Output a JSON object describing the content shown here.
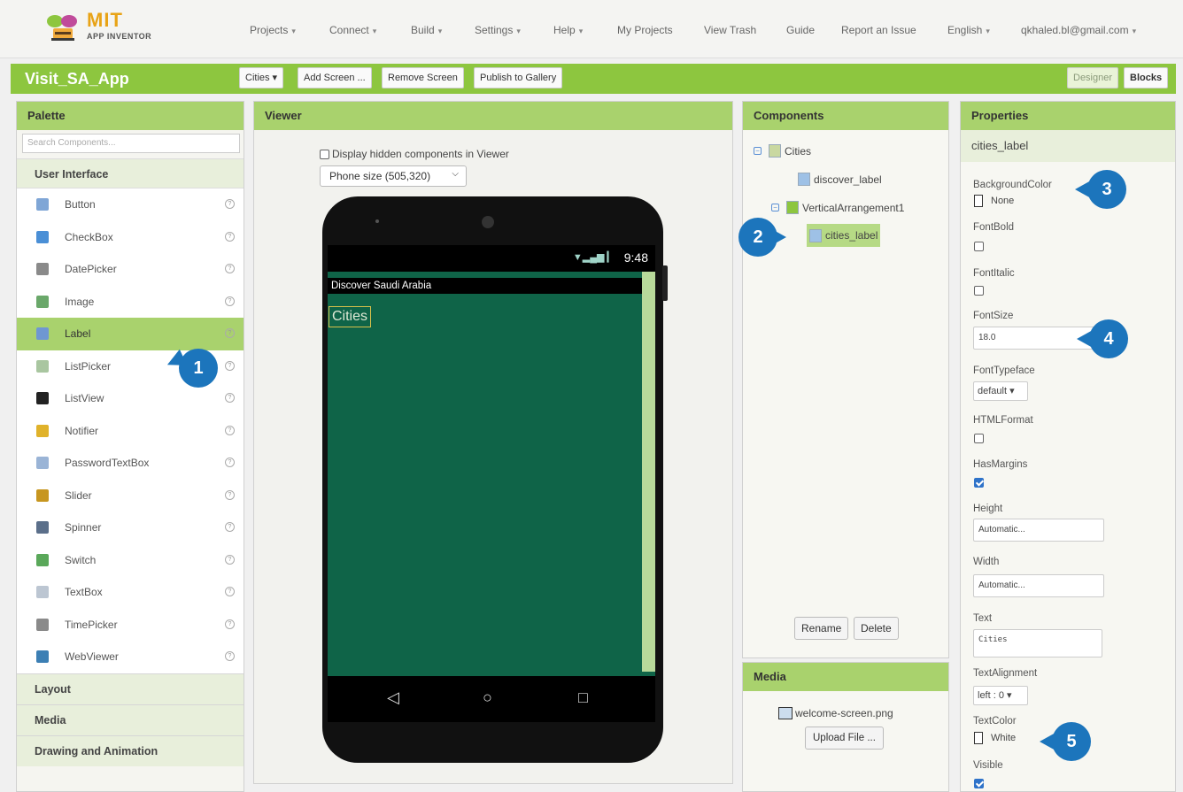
{
  "app": {
    "logo_top": "MIT",
    "logo_bottom": "APP INVENTOR",
    "nav": [
      {
        "label": "Projects",
        "caret": true
      },
      {
        "label": "Connect",
        "caret": true
      },
      {
        "label": "Build",
        "caret": true
      },
      {
        "label": "Settings",
        "caret": true
      },
      {
        "label": "Help",
        "caret": true
      },
      {
        "label": "My Projects",
        "caret": false
      },
      {
        "label": "View Trash",
        "caret": false
      },
      {
        "label": "Guide",
        "caret": false
      },
      {
        "label": "Report an Issue",
        "caret": false
      },
      {
        "label": "English",
        "caret": true
      },
      {
        "label": "qkhaled.bl@gmail.com",
        "caret": true
      }
    ]
  },
  "toolbar": {
    "project_name": "Visit_SA_App",
    "screen_select": "Cities ▾",
    "add_screen": "Add Screen ...",
    "remove_screen": "Remove Screen",
    "publish": "Publish to Gallery",
    "designer": "Designer",
    "blocks": "Blocks"
  },
  "palette": {
    "title": "Palette",
    "search_placeholder": "Search Components...",
    "category": "User Interface",
    "items": [
      {
        "label": "Button",
        "icon": "button-icon",
        "color": "#7fa6d6"
      },
      {
        "label": "CheckBox",
        "icon": "checkbox-icon",
        "color": "#4a8fd6"
      },
      {
        "label": "DatePicker",
        "icon": "datepicker-icon",
        "color": "#8a8a8a"
      },
      {
        "label": "Image",
        "icon": "image-icon",
        "color": "#6aa86a"
      },
      {
        "label": "Label",
        "icon": "label-icon",
        "color": "#6f97d2"
      },
      {
        "label": "ListPicker",
        "icon": "listpicker-icon",
        "color": "#a9c6a0"
      },
      {
        "label": "ListView",
        "icon": "listview-icon",
        "color": "#222222"
      },
      {
        "label": "Notifier",
        "icon": "notifier-icon",
        "color": "#e0b22a"
      },
      {
        "label": "PasswordTextBox",
        "icon": "password-icon",
        "color": "#9ab4d6"
      },
      {
        "label": "Slider",
        "icon": "slider-icon",
        "color": "#c7961f"
      },
      {
        "label": "Spinner",
        "icon": "spinner-icon",
        "color": "#5b6f8a"
      },
      {
        "label": "Switch",
        "icon": "switch-icon",
        "color": "#5aa85a"
      },
      {
        "label": "TextBox",
        "icon": "textbox-icon",
        "color": "#bcc6d2"
      },
      {
        "label": "TimePicker",
        "icon": "timepicker-icon",
        "color": "#8a8a8a"
      },
      {
        "label": "WebViewer",
        "icon": "webviewer-icon",
        "color": "#3c7fb4"
      }
    ],
    "selected_index": 4,
    "footer_categories": [
      "Layout",
      "Media",
      "Drawing and Animation"
    ]
  },
  "viewer": {
    "title": "Viewer",
    "hidden_checkbox_label": "Display hidden components in Viewer",
    "size_select": "Phone size (505,320)",
    "status_time": "9:48",
    "screen_title": "Discover Saudi Arabia",
    "label_text": "Cities"
  },
  "components": {
    "title": "Components",
    "tree": [
      {
        "label": "Cities",
        "level": 0,
        "toggle": "⊟"
      },
      {
        "label": "discover_label",
        "level": 1,
        "toggle": ""
      },
      {
        "label": "VerticalArrangement1",
        "level": 1,
        "toggle": "⊟"
      },
      {
        "label": "cities_label",
        "level": 2,
        "toggle": "",
        "selected": true
      }
    ],
    "rename": "Rename",
    "delete": "Delete"
  },
  "media": {
    "title": "Media",
    "file": "welcome-screen.png",
    "upload": "Upload File ..."
  },
  "properties": {
    "title": "Properties",
    "component": "cities_label",
    "background_color_label": "BackgroundColor",
    "background_color_value": "None",
    "font_bold_label": "FontBold",
    "font_italic_label": "FontItalic",
    "font_size_label": "FontSize",
    "font_size_value": "18.0",
    "font_typeface_label": "FontTypeface",
    "font_typeface_value": "default ▾",
    "html_format_label": "HTMLFormat",
    "has_margins_label": "HasMargins",
    "height_label": "Height",
    "height_value": "Automatic...",
    "width_label": "Width",
    "width_value": "Automatic...",
    "text_label": "Text",
    "text_value": "Cities",
    "text_alignment_label": "TextAlignment",
    "text_alignment_value": "left : 0 ▾",
    "text_color_label": "TextColor",
    "text_color_value": "White",
    "visible_label": "Visible"
  },
  "callouts": [
    "1",
    "2",
    "3",
    "4",
    "5"
  ],
  "colors": {
    "green": "#8dc63f",
    "panel_header": "#a9d26d",
    "callout": "#1c75bc",
    "screen": "#0f6448"
  }
}
